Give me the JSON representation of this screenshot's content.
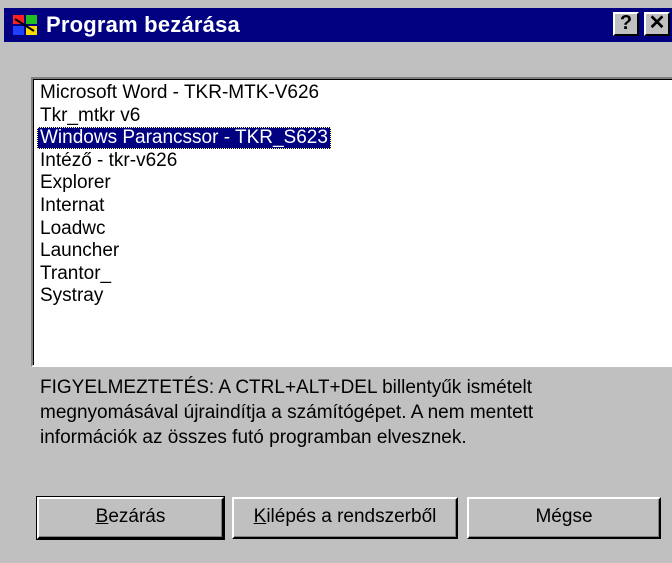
{
  "window": {
    "title": "Program bezárása",
    "help_label": "?",
    "close_label": "✕"
  },
  "program_list": {
    "selected_index": 2,
    "items": [
      "Microsoft Word - TKR-MTK-V626",
      "Tkr_mtkr v6",
      "Windows Parancssor - TKR_S623",
      "Intéző - tkr-v626",
      "Explorer",
      "Internat",
      "Loadwc",
      "Launcher",
      "Trantor_",
      "Systray"
    ]
  },
  "warning": {
    "line1": "FIGYELMEZTETÉS: A CTRL+ALT+DEL billentyűk ismételt",
    "line2": "megnyomásával újraindítja a számítógépet. A nem mentett",
    "line3": "információk az összes futó programban elvesznek."
  },
  "buttons": {
    "close_mnemonic": "B",
    "close_rest": "ezárás",
    "shutdown_mnemonic": "K",
    "shutdown_rest": "ilépés a rendszerből",
    "cancel": "Mégse"
  },
  "colors": {
    "titlebar": "#000080",
    "face": "#c0c0c0",
    "selection": "#000080"
  }
}
